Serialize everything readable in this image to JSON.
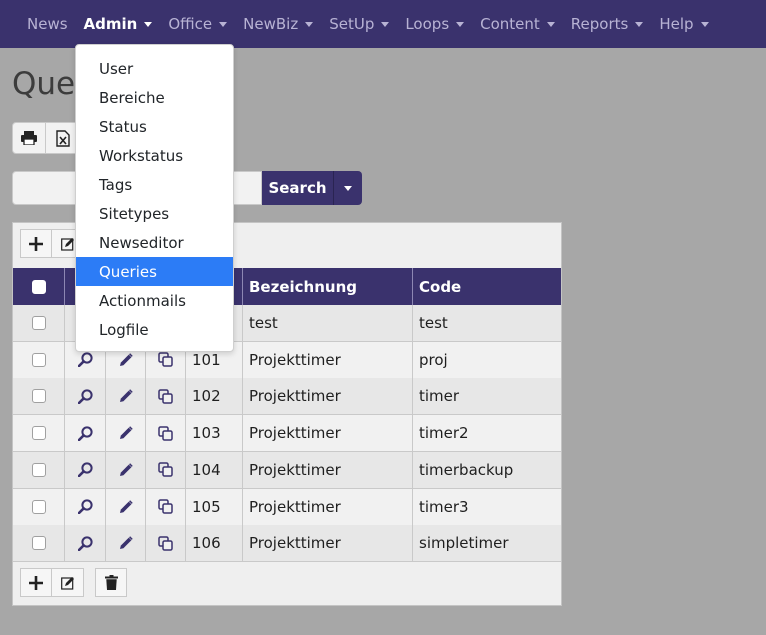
{
  "navbar": {
    "items": [
      {
        "label": "News",
        "has_caret": false
      },
      {
        "label": "Admin",
        "has_caret": true,
        "active": true
      },
      {
        "label": "Office",
        "has_caret": true
      },
      {
        "label": "NewBiz",
        "has_caret": true
      },
      {
        "label": "SetUp",
        "has_caret": true
      },
      {
        "label": "Loops",
        "has_caret": true
      },
      {
        "label": "Content",
        "has_caret": true
      },
      {
        "label": "Reports",
        "has_caret": true
      },
      {
        "label": "Help",
        "has_caret": true
      }
    ],
    "bg_color": "#3a326d"
  },
  "admin_menu": {
    "items": [
      "User",
      "Bereiche",
      "Status",
      "Workstatus",
      "Tags",
      "Sitetypes",
      "Newseditor",
      "Queries",
      "Actionmails",
      "Logfile"
    ],
    "active_index": 7,
    "active_color": "#2c7cf6"
  },
  "page": {
    "title": "Queries",
    "toolbar_icons": [
      "print-icon",
      "excel-icon"
    ]
  },
  "search": {
    "value": "",
    "placeholder": "",
    "button_label": "Search"
  },
  "table": {
    "columns": [
      "",
      "",
      "",
      "",
      "",
      "Bezeichnung",
      "Code"
    ],
    "rows": [
      {
        "id": "",
        "bezeichnung": "test",
        "code": "test"
      },
      {
        "id": "101",
        "bezeichnung": "Projekttimer",
        "code": "proj"
      },
      {
        "id": "102",
        "bezeichnung": "Projekttimer",
        "code": "timer"
      },
      {
        "id": "103",
        "bezeichnung": "Projekttimer",
        "code": "timer2"
      },
      {
        "id": "104",
        "bezeichnung": "Projekttimer",
        "code": "timerbackup"
      },
      {
        "id": "105",
        "bezeichnung": "Projekttimer",
        "code": "timer3"
      },
      {
        "id": "106",
        "bezeichnung": "Projekttimer",
        "code": "simpletimer"
      }
    ]
  },
  "icons": {
    "view": "magnifier-icon",
    "edit": "pencil-icon",
    "copy": "copy-icon",
    "add": "plus-icon",
    "edit_multi": "edit-icon",
    "delete": "trash-icon"
  }
}
